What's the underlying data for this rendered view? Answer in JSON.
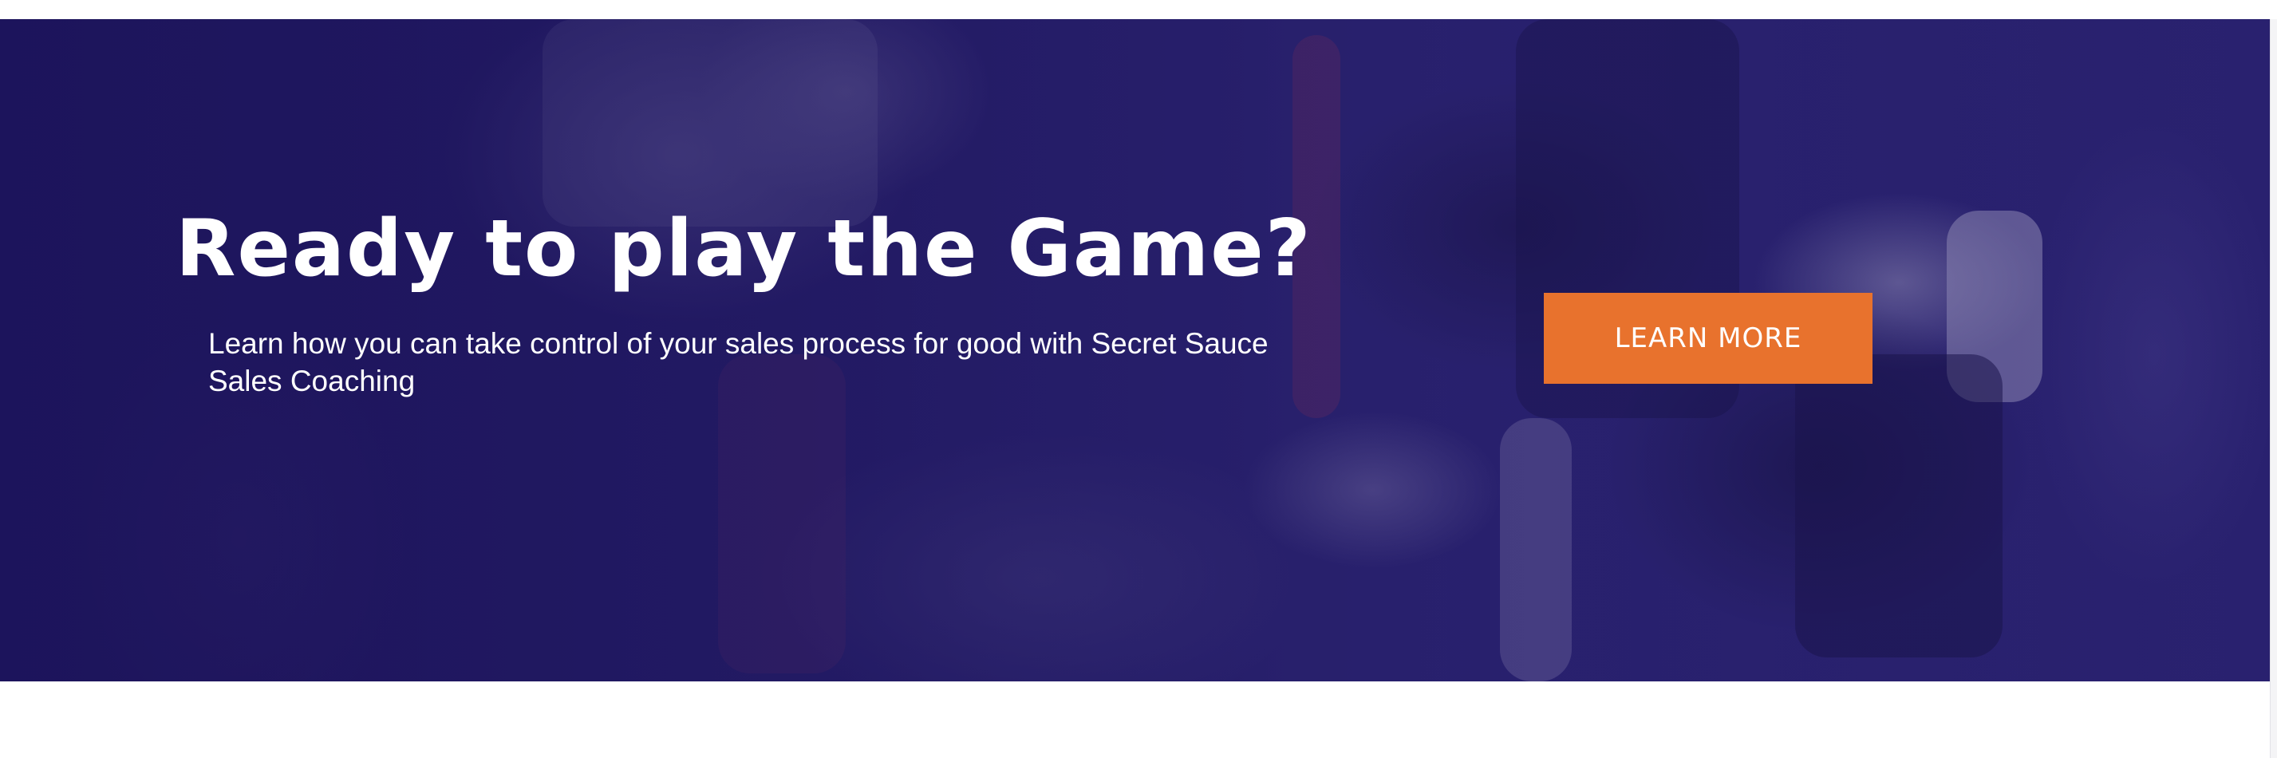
{
  "hero": {
    "headline": "Ready to play the Game?",
    "subtext": "Learn how you can take control of your sales process for good with Secret Sauce Sales Coaching",
    "cta_label": "LEARN MORE"
  },
  "colors": {
    "overlay": "#221a5e",
    "cta_background": "#e8722d",
    "text": "#ffffff"
  }
}
